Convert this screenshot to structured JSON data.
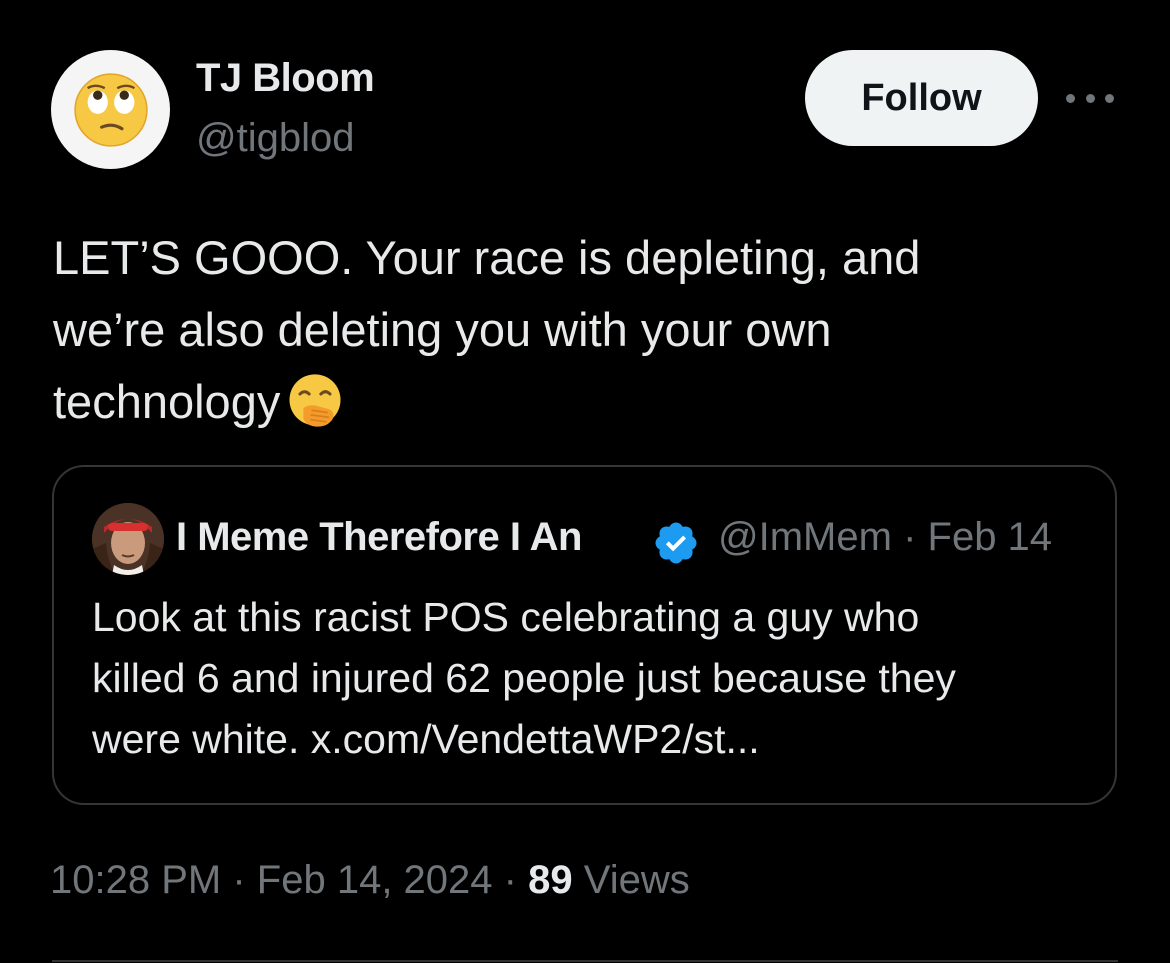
{
  "author": {
    "display_name": "TJ Bloom",
    "handle": "@tigblod",
    "avatar_icon": "face-with-rolling-eyes-emoji"
  },
  "follow_label": "Follow",
  "more_icon": "more-horizontal-icon",
  "tweet": {
    "lines": [
      "LET’S GOOO. Your race is depleting, and",
      "we’re also deleting you with your own",
      "technology"
    ],
    "trailing_emoji": "face-with-hand-over-mouth-emoji"
  },
  "quote": {
    "display_name": "I Meme Therefore I An",
    "verified": true,
    "handle": "@ImMem",
    "separator": "·",
    "date": "Feb 14",
    "lines": [
      "Look at this racist POS celebrating a guy who",
      "killed 6 and injured 62 people just because they",
      "were white. x.com/VendettaWP2/st..."
    ]
  },
  "footer": {
    "time": "10:28 PM",
    "separator": "·",
    "date": "Feb 14, 2024",
    "views_count": "89",
    "views_label": "Views"
  },
  "colors": {
    "background": "#000000",
    "primary_text": "#e7e9ea",
    "secondary_text": "#71767b",
    "border": "#333639",
    "verified_blue": "#1d9bf0",
    "follow_button_bg": "#eff3f4"
  }
}
